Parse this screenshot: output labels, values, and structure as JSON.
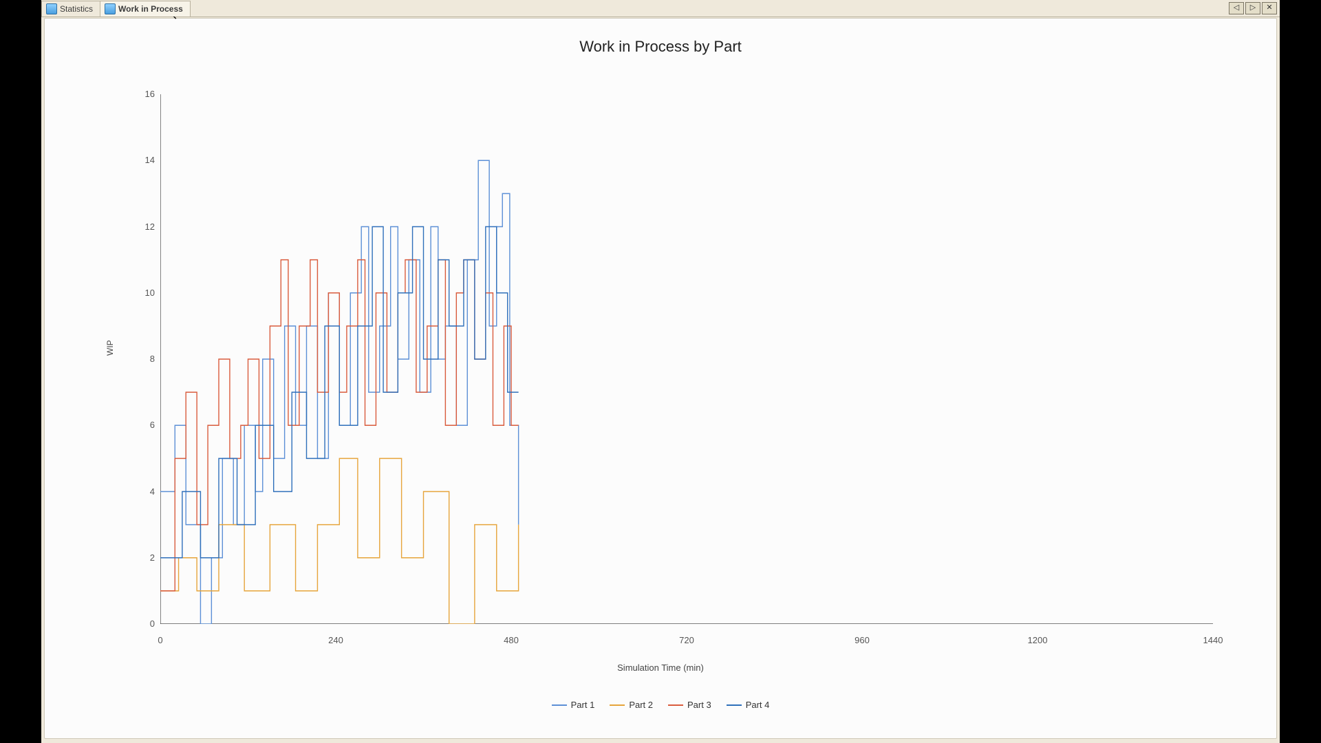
{
  "tabs": [
    {
      "label": "Statistics",
      "active": false
    },
    {
      "label": "Work in Process",
      "active": true
    }
  ],
  "window_buttons": {
    "prev": "◁",
    "next": "▷",
    "close": "✕"
  },
  "colors": {
    "part1": "#5b8fd6",
    "part2": "#e6a43a",
    "part3": "#d95b3c",
    "part4": "#2e6fba"
  },
  "chart_data": {
    "type": "line",
    "title": "Work in Process by Part",
    "xlabel": "Simulation Time (min)",
    "ylabel": "WIP",
    "xlim": [
      0,
      1440
    ],
    "ylim": [
      0,
      16
    ],
    "xticks": [
      0,
      240,
      480,
      720,
      960,
      1200,
      1440
    ],
    "yticks": [
      0,
      2,
      4,
      6,
      8,
      10,
      12,
      14,
      16
    ],
    "legend": [
      "Part 1",
      "Part 2",
      "Part 3",
      "Part 4"
    ],
    "series": [
      {
        "name": "Part 1",
        "color_key": "part1",
        "points": [
          [
            0,
            4
          ],
          [
            20,
            4
          ],
          [
            20,
            6
          ],
          [
            35,
            6
          ],
          [
            35,
            3
          ],
          [
            55,
            3
          ],
          [
            55,
            0
          ],
          [
            70,
            0
          ],
          [
            70,
            2
          ],
          [
            85,
            2
          ],
          [
            85,
            5
          ],
          [
            100,
            5
          ],
          [
            100,
            3
          ],
          [
            115,
            3
          ],
          [
            115,
            6
          ],
          [
            130,
            6
          ],
          [
            130,
            4
          ],
          [
            140,
            4
          ],
          [
            140,
            8
          ],
          [
            155,
            8
          ],
          [
            155,
            5
          ],
          [
            170,
            5
          ],
          [
            170,
            9
          ],
          [
            185,
            9
          ],
          [
            185,
            6
          ],
          [
            200,
            6
          ],
          [
            200,
            9
          ],
          [
            215,
            9
          ],
          [
            215,
            5
          ],
          [
            230,
            5
          ],
          [
            230,
            10
          ],
          [
            245,
            10
          ],
          [
            245,
            6
          ],
          [
            260,
            6
          ],
          [
            260,
            10
          ],
          [
            275,
            10
          ],
          [
            275,
            12
          ],
          [
            285,
            12
          ],
          [
            285,
            7
          ],
          [
            300,
            7
          ],
          [
            300,
            9
          ],
          [
            315,
            9
          ],
          [
            315,
            12
          ],
          [
            325,
            12
          ],
          [
            325,
            8
          ],
          [
            340,
            8
          ],
          [
            340,
            11
          ],
          [
            355,
            11
          ],
          [
            355,
            7
          ],
          [
            370,
            7
          ],
          [
            370,
            12
          ],
          [
            380,
            12
          ],
          [
            380,
            8
          ],
          [
            390,
            8
          ],
          [
            390,
            9
          ],
          [
            405,
            9
          ],
          [
            405,
            6
          ],
          [
            420,
            6
          ],
          [
            420,
            11
          ],
          [
            435,
            11
          ],
          [
            435,
            14
          ],
          [
            450,
            14
          ],
          [
            450,
            9
          ],
          [
            460,
            9
          ],
          [
            460,
            12
          ],
          [
            468,
            12
          ],
          [
            468,
            13
          ],
          [
            478,
            13
          ],
          [
            478,
            6
          ],
          [
            490,
            6
          ],
          [
            490,
            3
          ]
        ]
      },
      {
        "name": "Part 2",
        "color_key": "part2",
        "points": [
          [
            0,
            1
          ],
          [
            25,
            1
          ],
          [
            25,
            2
          ],
          [
            50,
            2
          ],
          [
            50,
            1
          ],
          [
            80,
            1
          ],
          [
            80,
            3
          ],
          [
            115,
            3
          ],
          [
            115,
            1
          ],
          [
            150,
            1
          ],
          [
            150,
            3
          ],
          [
            185,
            3
          ],
          [
            185,
            1
          ],
          [
            215,
            1
          ],
          [
            215,
            3
          ],
          [
            245,
            3
          ],
          [
            245,
            5
          ],
          [
            270,
            5
          ],
          [
            270,
            2
          ],
          [
            300,
            2
          ],
          [
            300,
            5
          ],
          [
            330,
            5
          ],
          [
            330,
            2
          ],
          [
            360,
            2
          ],
          [
            360,
            4
          ],
          [
            395,
            4
          ],
          [
            395,
            0
          ],
          [
            430,
            0
          ],
          [
            430,
            3
          ],
          [
            460,
            3
          ],
          [
            460,
            1
          ],
          [
            490,
            1
          ],
          [
            490,
            3
          ]
        ]
      },
      {
        "name": "Part 3",
        "color_key": "part3",
        "points": [
          [
            0,
            1
          ],
          [
            20,
            1
          ],
          [
            20,
            5
          ],
          [
            35,
            5
          ],
          [
            35,
            7
          ],
          [
            50,
            7
          ],
          [
            50,
            3
          ],
          [
            65,
            3
          ],
          [
            65,
            6
          ],
          [
            80,
            6
          ],
          [
            80,
            8
          ],
          [
            95,
            8
          ],
          [
            95,
            5
          ],
          [
            110,
            5
          ],
          [
            110,
            6
          ],
          [
            120,
            6
          ],
          [
            120,
            8
          ],
          [
            135,
            8
          ],
          [
            135,
            5
          ],
          [
            150,
            5
          ],
          [
            150,
            9
          ],
          [
            165,
            9
          ],
          [
            165,
            11
          ],
          [
            175,
            11
          ],
          [
            175,
            6
          ],
          [
            190,
            6
          ],
          [
            190,
            9
          ],
          [
            205,
            9
          ],
          [
            205,
            11
          ],
          [
            215,
            11
          ],
          [
            215,
            7
          ],
          [
            230,
            7
          ],
          [
            230,
            10
          ],
          [
            245,
            10
          ],
          [
            245,
            7
          ],
          [
            255,
            7
          ],
          [
            255,
            9
          ],
          [
            270,
            9
          ],
          [
            270,
            11
          ],
          [
            280,
            11
          ],
          [
            280,
            6
          ],
          [
            295,
            6
          ],
          [
            295,
            10
          ],
          [
            310,
            10
          ],
          [
            310,
            7
          ],
          [
            325,
            7
          ],
          [
            325,
            10
          ],
          [
            335,
            10
          ],
          [
            335,
            11
          ],
          [
            350,
            11
          ],
          [
            350,
            7
          ],
          [
            365,
            7
          ],
          [
            365,
            9
          ],
          [
            380,
            9
          ],
          [
            380,
            11
          ],
          [
            390,
            11
          ],
          [
            390,
            6
          ],
          [
            405,
            6
          ],
          [
            405,
            10
          ],
          [
            415,
            10
          ],
          [
            415,
            11
          ],
          [
            430,
            11
          ],
          [
            430,
            8
          ],
          [
            445,
            8
          ],
          [
            445,
            10
          ],
          [
            455,
            10
          ],
          [
            455,
            6
          ],
          [
            470,
            6
          ],
          [
            470,
            9
          ],
          [
            480,
            9
          ],
          [
            480,
            6
          ],
          [
            490,
            6
          ]
        ]
      },
      {
        "name": "Part 4",
        "color_key": "part4",
        "points": [
          [
            0,
            2
          ],
          [
            30,
            2
          ],
          [
            30,
            4
          ],
          [
            55,
            4
          ],
          [
            55,
            2
          ],
          [
            80,
            2
          ],
          [
            80,
            5
          ],
          [
            105,
            5
          ],
          [
            105,
            3
          ],
          [
            130,
            3
          ],
          [
            130,
            6
          ],
          [
            155,
            6
          ],
          [
            155,
            4
          ],
          [
            180,
            4
          ],
          [
            180,
            7
          ],
          [
            200,
            7
          ],
          [
            200,
            5
          ],
          [
            225,
            5
          ],
          [
            225,
            9
          ],
          [
            245,
            9
          ],
          [
            245,
            6
          ],
          [
            270,
            6
          ],
          [
            270,
            9
          ],
          [
            290,
            9
          ],
          [
            290,
            12
          ],
          [
            305,
            12
          ],
          [
            305,
            7
          ],
          [
            325,
            7
          ],
          [
            325,
            10
          ],
          [
            345,
            10
          ],
          [
            345,
            12
          ],
          [
            360,
            12
          ],
          [
            360,
            8
          ],
          [
            380,
            8
          ],
          [
            380,
            11
          ],
          [
            395,
            11
          ],
          [
            395,
            9
          ],
          [
            415,
            9
          ],
          [
            415,
            11
          ],
          [
            430,
            11
          ],
          [
            430,
            8
          ],
          [
            445,
            8
          ],
          [
            445,
            12
          ],
          [
            460,
            12
          ],
          [
            460,
            10
          ],
          [
            475,
            10
          ],
          [
            475,
            7
          ],
          [
            490,
            7
          ]
        ]
      }
    ]
  }
}
